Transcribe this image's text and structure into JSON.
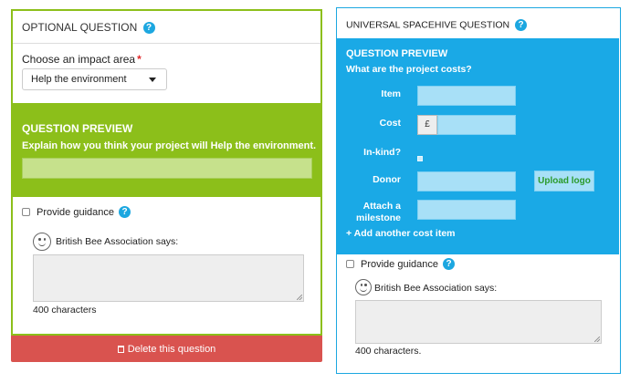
{
  "optional_question": {
    "header": "OPTIONAL QUESTION",
    "help_glyph": "?",
    "impact_label": "Choose an impact area",
    "required_mark": "*",
    "select_value": "Help the environment",
    "preview_title": "QUESTION PREVIEW",
    "preview_question": "Explain how you think your project will Help the environment.",
    "guidance_label": "Provide guidance",
    "says": "British Bee Association says:",
    "char_count": "400 characters",
    "delete_label": "Delete this question",
    "accent": "#8cbf1a"
  },
  "universal_question": {
    "header": "UNIVERSAL SPACEHIVE QUESTION",
    "preview_title": "QUESTION PREVIEW",
    "preview_question": "What are the project costs?",
    "fields": {
      "item": "Item",
      "cost": "Cost",
      "currency": "£",
      "in_kind": "In-kind?",
      "donor": "Donor",
      "milestone": "Attach a milestone"
    },
    "upload_label": "Upload logo",
    "add_cost": "+ Add another cost item",
    "guidance_label": "Provide guidance",
    "says": "British Bee Association says:",
    "char_count": "400 characters.",
    "accent": "#1aa9e6"
  },
  "delete_color": "#d9534f"
}
